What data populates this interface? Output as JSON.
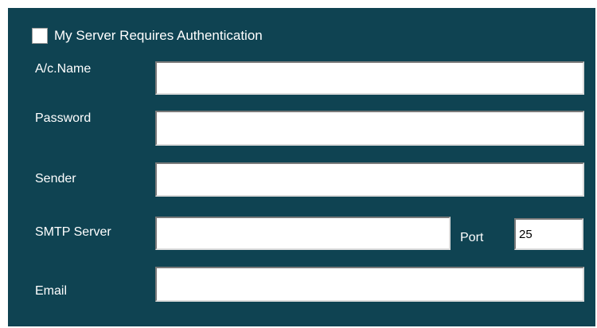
{
  "auth": {
    "checkbox_checked": false,
    "label": "My Server Requires Authentication"
  },
  "fields": {
    "account_name": {
      "label": "A/c.Name",
      "value": ""
    },
    "password": {
      "label": "Password",
      "value": ""
    },
    "sender": {
      "label": "Sender",
      "value": ""
    },
    "smtp_server": {
      "label": "SMTP Server",
      "value": ""
    },
    "port": {
      "label": "Port",
      "value": "25"
    },
    "email": {
      "label": "Email",
      "value": ""
    }
  },
  "colors": {
    "panel_background": "#0f4352",
    "label_text": "#ffffff",
    "field_background": "#ffffff"
  }
}
